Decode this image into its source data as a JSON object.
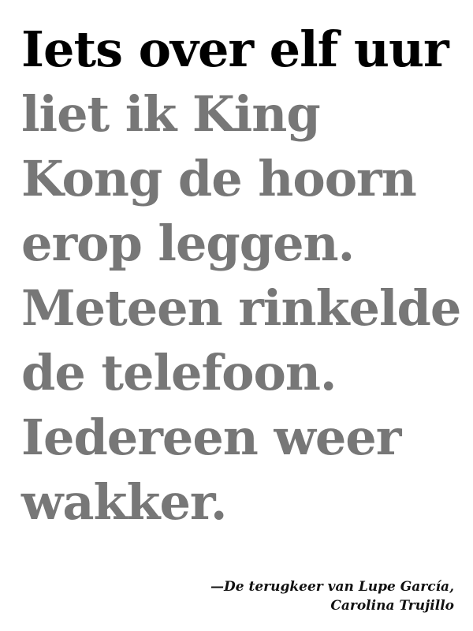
{
  "quote": {
    "lead": "Iets over elf uur",
    "rest": " liet ik King Kong de hoorn erop leggen. Meteen rinkelde de telefoon. Iedereen weer wakker."
  },
  "attribution": {
    "line1": "—De terugkeer van Lupe García,",
    "line2": "Carolina Trujillo"
  },
  "colors": {
    "lead": "#000000",
    "rest": "#777777",
    "background": "#ffffff"
  }
}
